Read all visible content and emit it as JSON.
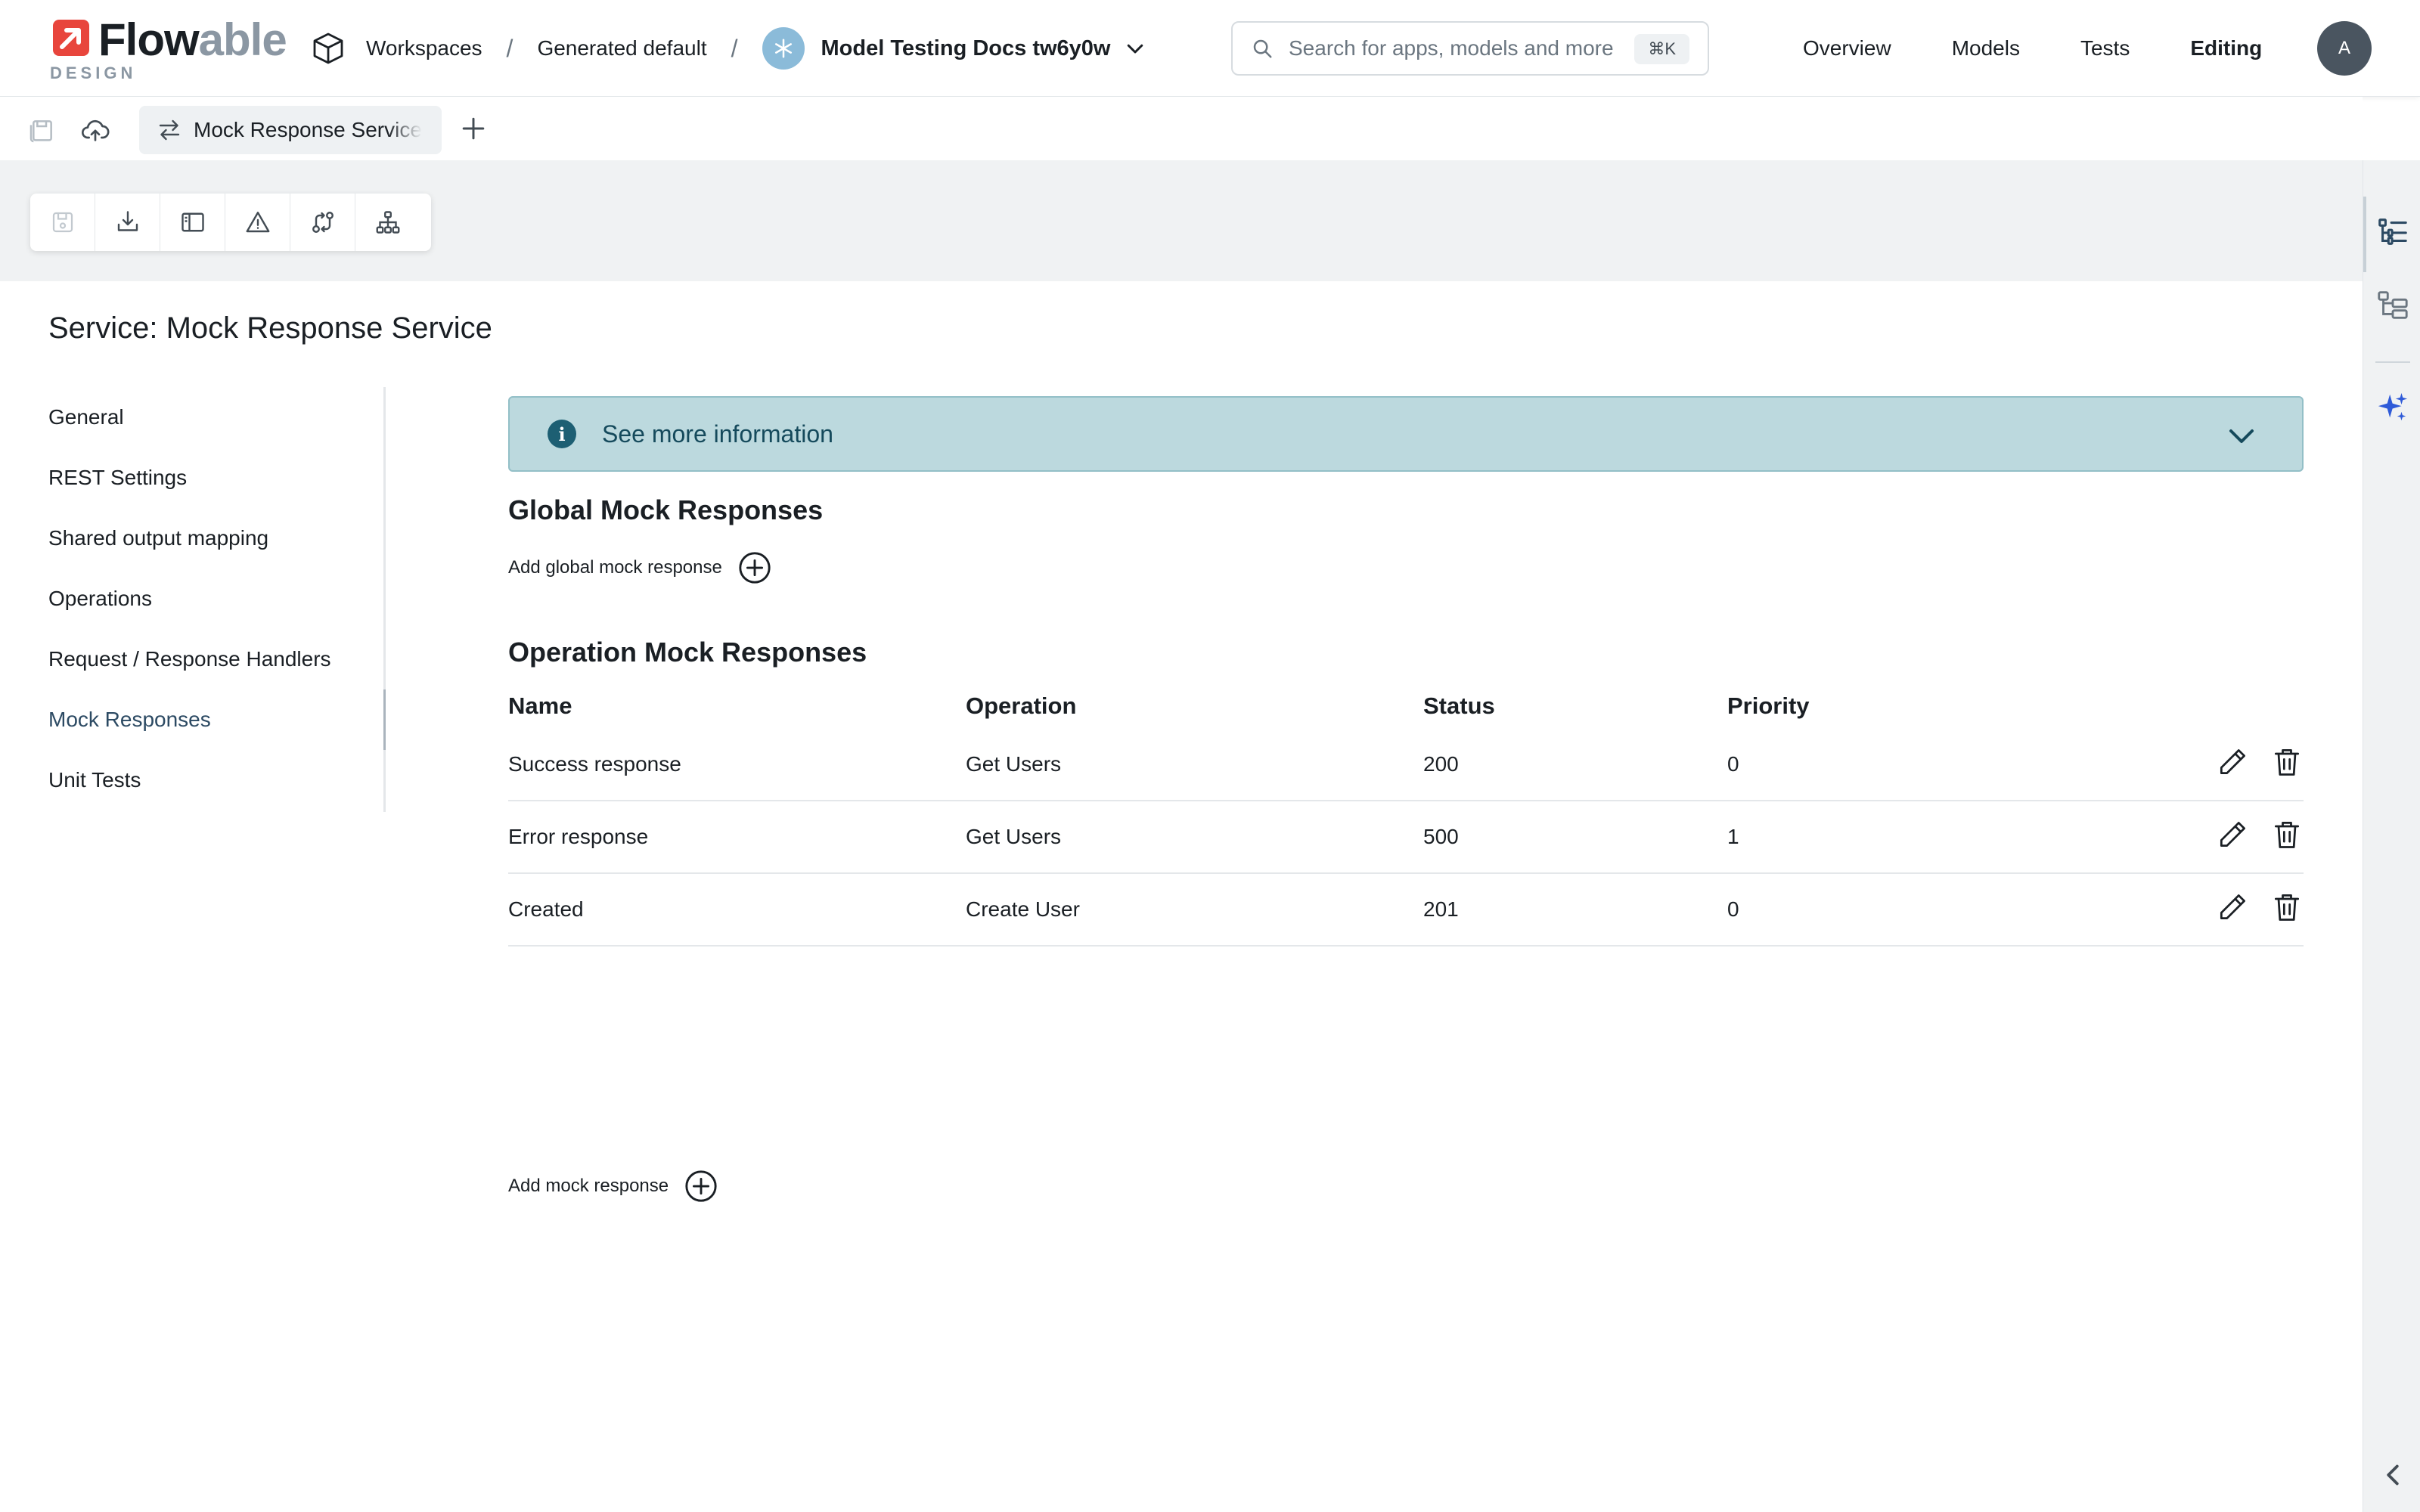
{
  "brand": {
    "name_a": "Flow",
    "name_b": "able",
    "sub": "DESIGN"
  },
  "breadcrumb": {
    "workspaces": "Workspaces",
    "sep": "/",
    "folder": "Generated default",
    "current": "Model Testing Docs tw6y0w"
  },
  "search": {
    "placeholder": "Search for apps, models and more",
    "shortcut": "⌘K"
  },
  "topnav": {
    "overview": "Overview",
    "models": "Models",
    "tests": "Tests",
    "editing": "Editing"
  },
  "user": {
    "initial": "A"
  },
  "tabs": {
    "open_doc": "Mock Response Service"
  },
  "page": {
    "title": "Service: Mock Response Service"
  },
  "sidebar": {
    "items": [
      {
        "label": "General"
      },
      {
        "label": "REST Settings"
      },
      {
        "label": "Shared output mapping"
      },
      {
        "label": "Operations"
      },
      {
        "label": "Request / Response Handlers"
      },
      {
        "label": "Mock Responses",
        "active": true
      },
      {
        "label": "Unit Tests"
      }
    ]
  },
  "info": {
    "label": "See more information"
  },
  "global": {
    "heading": "Global Mock Responses",
    "add_label": "Add global mock response"
  },
  "operation": {
    "heading": "Operation Mock Responses",
    "columns": {
      "name": "Name",
      "operation": "Operation",
      "status": "Status",
      "priority": "Priority"
    },
    "rows": [
      {
        "name": "Success response",
        "operation": "Get Users",
        "status": "200",
        "priority": "0"
      },
      {
        "name": "Error response",
        "operation": "Get Users",
        "status": "500",
        "priority": "1"
      },
      {
        "name": "Created",
        "operation": "Create User",
        "status": "201",
        "priority": "0"
      }
    ],
    "add_label": "Add mock response"
  },
  "colors": {
    "brand_red": "#e8453c",
    "info_bg": "#bcd9de",
    "info_text": "#154a5c",
    "ai_blue": "#2f5bd8"
  }
}
